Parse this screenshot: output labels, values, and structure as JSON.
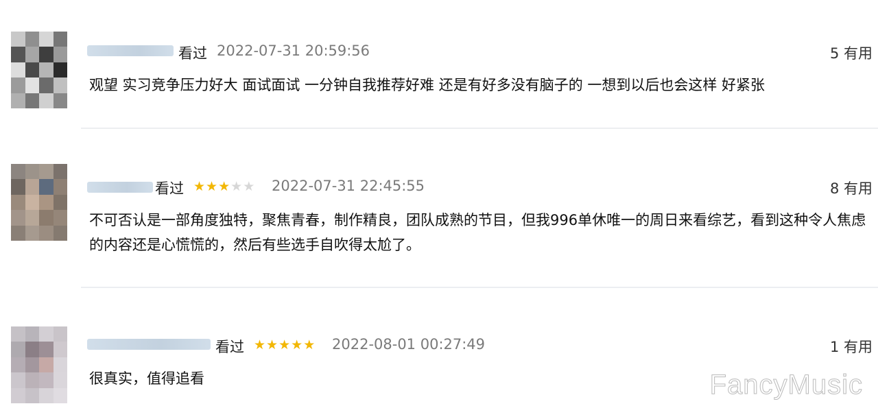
{
  "reviews": [
    {
      "seen_label": "看过",
      "stars": 0,
      "time": "2022-07-31 20:59:56",
      "useful": "5 有用",
      "text": "观望 实习竞争压力好大 面试面试 一分钟自我推荐好难 还是有好多没有脑子的 一想到以后也会这样 好紧张"
    },
    {
      "seen_label": "看过",
      "stars": 3,
      "time": "2022-07-31 22:45:55",
      "useful": "8 有用",
      "text": "不可否认是一部角度独特，聚焦青春，制作精良，团队成熟的节目，但我996单休唯一的周日来看综艺，看到这种令人焦虑的内容还是心慌慌的，然后有些选手自吹得太尬了。"
    },
    {
      "seen_label": "看过",
      "stars": 5,
      "time": "2022-08-01 00:27:49",
      "useful": "1 有用",
      "text": "很真实，值得追看"
    }
  ],
  "watermark": "FancyMusic",
  "colors": {
    "star": "#f2b705",
    "star_off": "#d7d7d7",
    "time": "#7a7a7a"
  }
}
